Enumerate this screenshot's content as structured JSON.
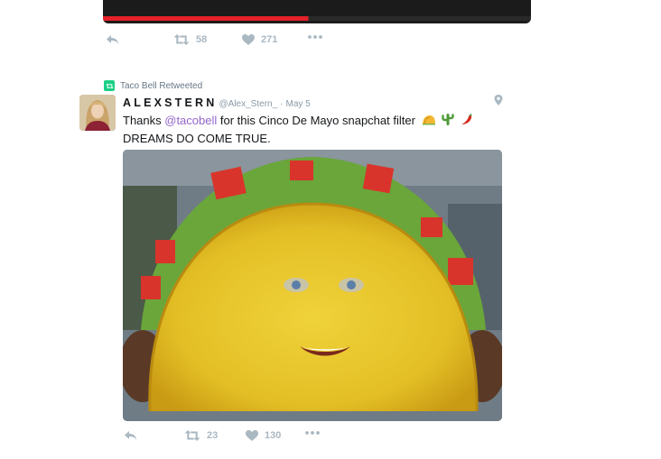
{
  "previous_tweet": {
    "retweets": "58",
    "likes": "271"
  },
  "tweet": {
    "retweeted_by": "Taco Bell Retweeted",
    "author_name": "ALEXSTERN",
    "author_handle": "@Alex_Stern_",
    "separator": "·",
    "timestamp": "May 5",
    "text_before": "Thanks ",
    "mention": "@tacobell",
    "text_after": " for this Cinco De Mayo snapchat filter",
    "text_line2": "DREAMS DO COME TRUE.",
    "emojis": [
      "taco-emoji",
      "cactus-emoji",
      "chili-pepper-emoji"
    ],
    "media_description_icon": "taco-face-filter-photo",
    "retweets": "23",
    "likes": "130"
  },
  "colors": {
    "retweet_green": "#19cf86",
    "mention_purple": "#9266cc",
    "muted_gray": "#aab8c2",
    "meta_gray": "#8899a6"
  }
}
